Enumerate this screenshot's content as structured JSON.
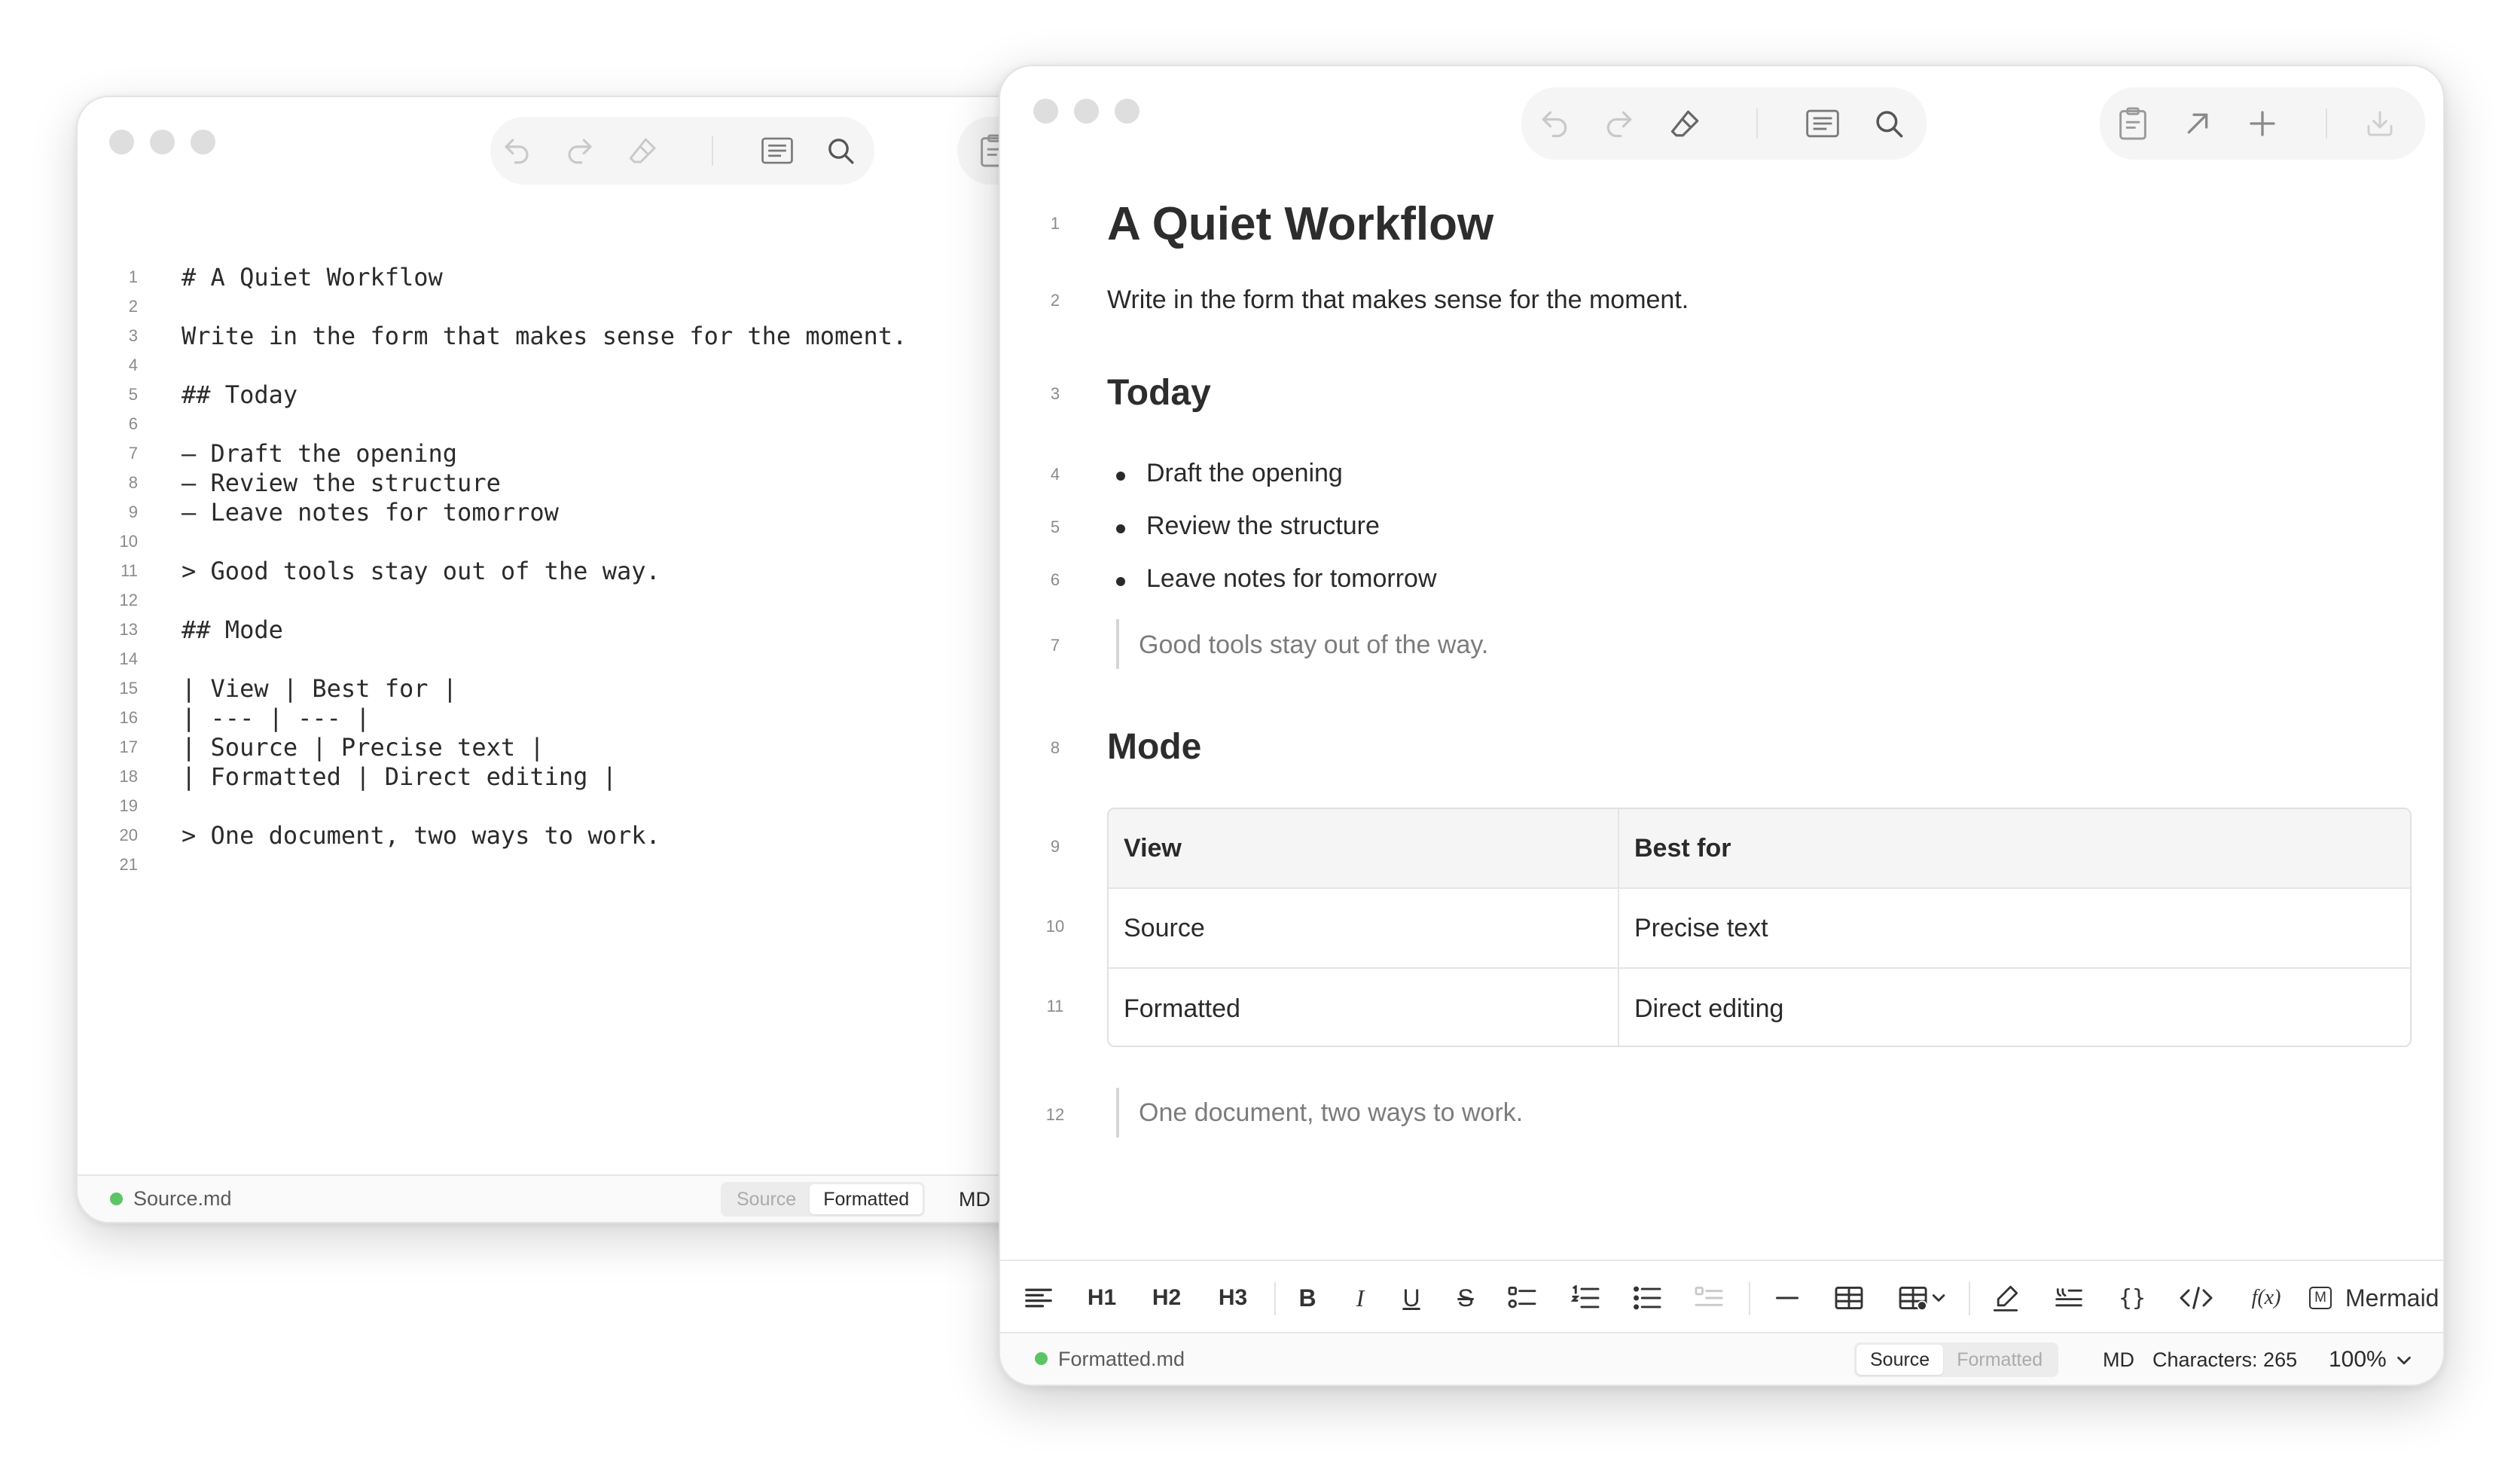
{
  "source_window": {
    "lines": [
      {
        "num": "1",
        "text": "# A Quiet Workflow"
      },
      {
        "num": "2",
        "text": ""
      },
      {
        "num": "3",
        "text": "Write in the form that makes sense for the moment."
      },
      {
        "num": "4",
        "text": ""
      },
      {
        "num": "5",
        "text": "## Today"
      },
      {
        "num": "6",
        "text": ""
      },
      {
        "num": "7",
        "text": "– Draft the opening"
      },
      {
        "num": "8",
        "text": "– Review the structure"
      },
      {
        "num": "9",
        "text": "– Leave notes for tomorrow"
      },
      {
        "num": "10",
        "text": ""
      },
      {
        "num": "11",
        "text": "> Good tools stay out of the way."
      },
      {
        "num": "12",
        "text": ""
      },
      {
        "num": "13",
        "text": "## Mode"
      },
      {
        "num": "14",
        "text": ""
      },
      {
        "num": "15",
        "text": "| View | Best for |"
      },
      {
        "num": "16",
        "text": "| --- | --- |"
      },
      {
        "num": "17",
        "text": "| Source | Precise text |"
      },
      {
        "num": "18",
        "text": "| Formatted | Direct editing |"
      },
      {
        "num": "19",
        "text": ""
      },
      {
        "num": "20",
        "text": "> One document, two ways to work."
      },
      {
        "num": "21",
        "text": ""
      }
    ],
    "status": {
      "filename": "Source.md",
      "source_label": "Source",
      "formatted_label": "Formatted",
      "format": "MD"
    }
  },
  "formatted_window": {
    "title": {
      "num": "1",
      "text": "A Quiet Workflow"
    },
    "intro": {
      "num": "2",
      "text": "Write in the form that makes sense for the moment."
    },
    "heading_today": {
      "num": "3",
      "text": "Today"
    },
    "list": [
      {
        "num": "4",
        "text": "Draft the opening"
      },
      {
        "num": "5",
        "text": "Review the structure"
      },
      {
        "num": "6",
        "text": "Leave notes for tomorrow"
      }
    ],
    "quote1": {
      "num": "7",
      "text": "Good tools stay out of the way."
    },
    "heading_mode": {
      "num": "8",
      "text": "Mode"
    },
    "table": {
      "nums": [
        "9",
        "10",
        "11"
      ],
      "headers": [
        "View",
        "Best for"
      ],
      "rows": [
        [
          "Source",
          "Precise text"
        ],
        [
          "Formatted",
          "Direct editing"
        ]
      ]
    },
    "quote2": {
      "num": "12",
      "text": "One document, two ways to work."
    },
    "format_toolbar": {
      "h1": "H1",
      "h2": "H2",
      "h3": "H3",
      "bold": "B",
      "italic": "I",
      "underline": "U",
      "strike": "S",
      "code_block": "{}",
      "formula": "f(x)",
      "mermaid": "Mermaid"
    },
    "status": {
      "filename": "Formatted.md",
      "source_label": "Source",
      "formatted_label": "Formatted",
      "format": "MD",
      "characters": "Characters: 265",
      "zoom": "100%"
    }
  },
  "colors": {
    "status_dot": "#5dc466",
    "traffic_light": "#dedede"
  }
}
